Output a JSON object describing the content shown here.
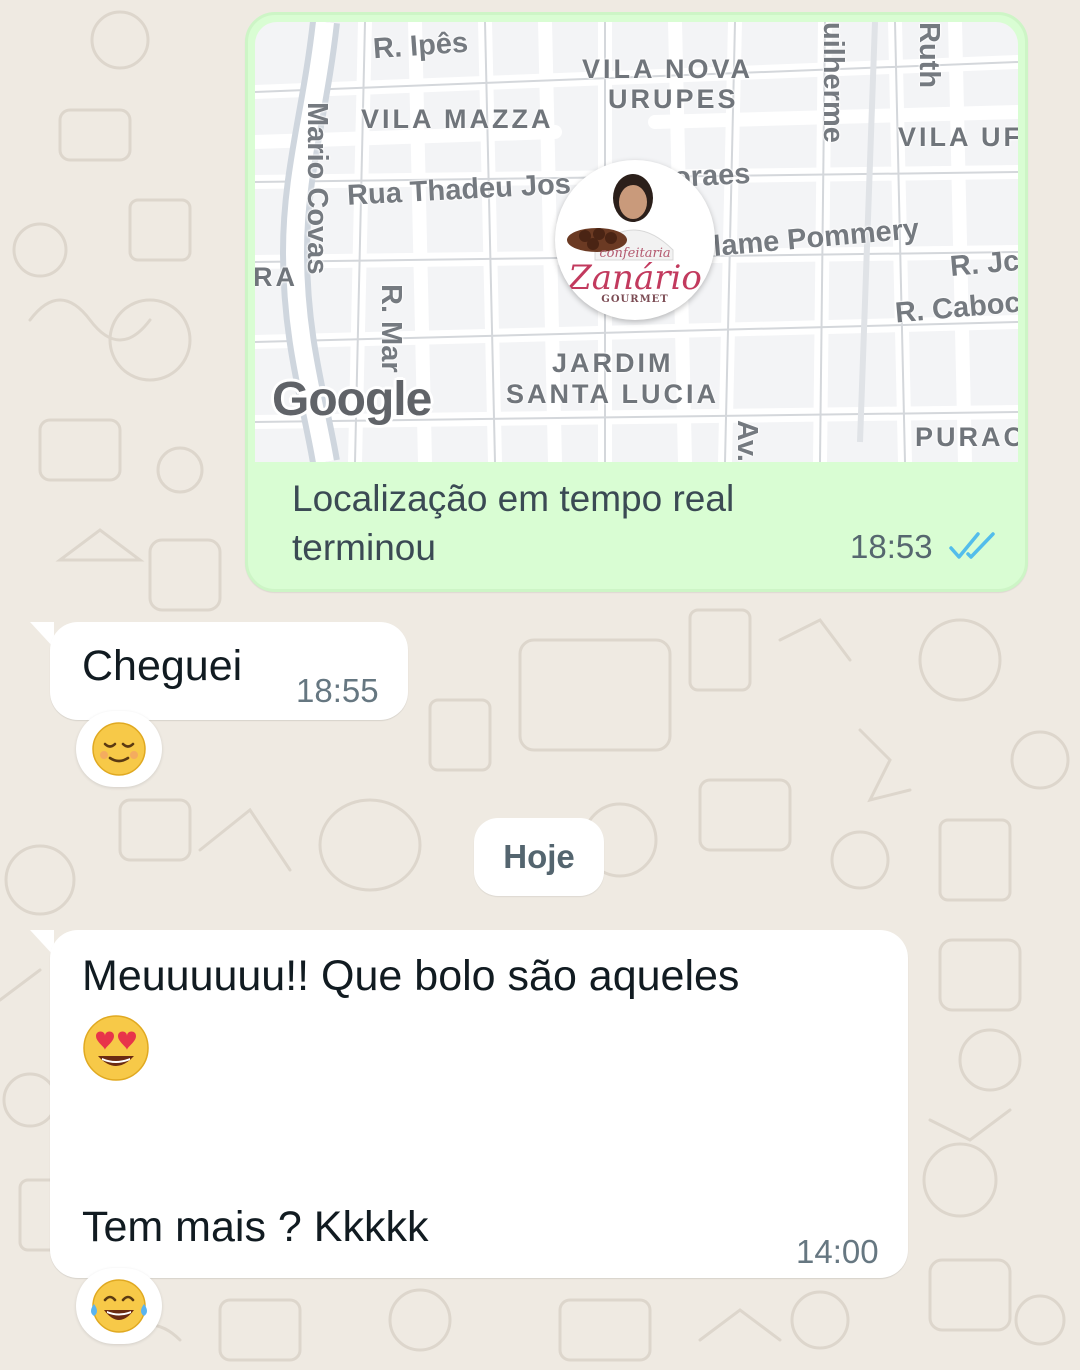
{
  "live_location": {
    "map": {
      "districts": [
        "VILA NOVA",
        "URUPES",
        "VILA MAZZA",
        "VILA UF",
        "JARDIM",
        "SANTA LUCIA",
        "PURAC",
        "RA"
      ],
      "streets": [
        "R. Ipês",
        "Mario Covas",
        "Rua Thadeu Jos",
        "oraes",
        "lame Pommery",
        "R. Jc",
        "R. Caboc",
        "R. Mar",
        "uilherme",
        "Ruth",
        "Av."
      ],
      "provider_logo": "Google"
    },
    "avatar": {
      "brand_top": "confeitaria",
      "brand_name": "Zanário",
      "brand_bottom": "GOURMET"
    },
    "text": "Localização em tempo real terminou",
    "time": "18:53",
    "status_icon": "double-check-read-icon",
    "read_color": "#53bdeb"
  },
  "messages": [
    {
      "text": "Cheguei",
      "time": "18:55",
      "reaction": "😌"
    },
    {
      "lines": [
        "Meuuuuuu!! Que bolo são aqueles",
        "😍",
        "",
        "Tem mais ? Kkkkk"
      ],
      "time": "14:00",
      "reaction": "😂"
    }
  ],
  "date_divider": "Hoje",
  "colors": {
    "chat_background": "#efeae2",
    "outgoing_bubble": "#d9fdd3",
    "incoming_bubble": "#ffffff"
  }
}
